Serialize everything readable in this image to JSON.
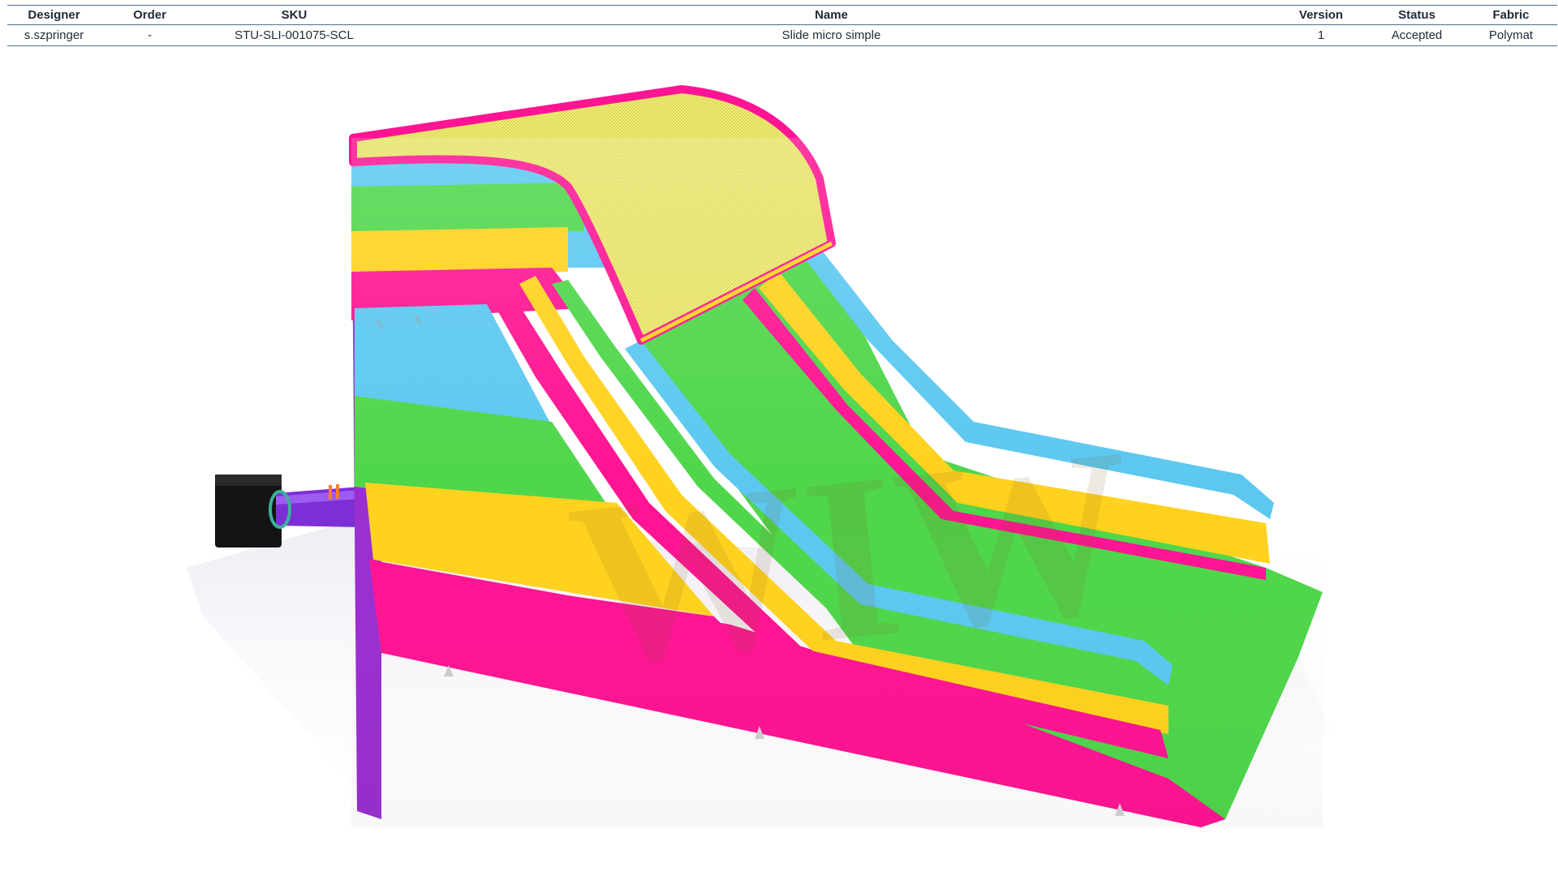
{
  "table": {
    "headers": {
      "designer": "Designer",
      "order": "Order",
      "sku": "SKU",
      "name": "Name",
      "version": "Version",
      "status": "Status",
      "fabric": "Fabric"
    },
    "row": {
      "designer": "s.szpringer",
      "order": "-",
      "sku": "STU-SLI-001075-SCL",
      "name": "Slide micro simple",
      "version": "1",
      "status": "Accepted",
      "fabric": "Polymat"
    }
  },
  "render": {
    "watermark_text": "WIW",
    "colors": {
      "pink": "#ff1493",
      "green": "#4fd64a",
      "yellow": "#ffd21e",
      "blue": "#5cc8f0",
      "purple": "#8a2be2",
      "blower": "#111111"
    }
  }
}
